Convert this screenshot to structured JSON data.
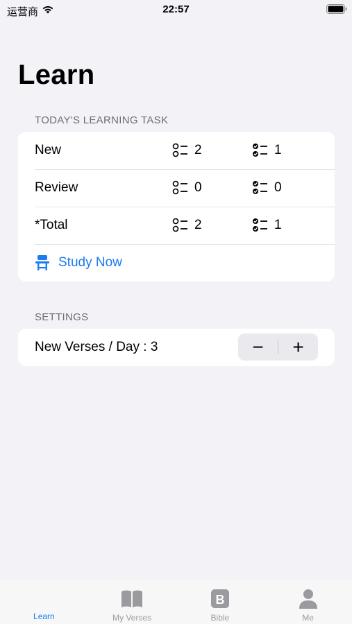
{
  "status_bar": {
    "carrier": "运营商",
    "time": "22:57"
  },
  "page": {
    "title": "Learn"
  },
  "todays_task": {
    "header": "TODAY'S LEARNING TASK",
    "rows": [
      {
        "label": "New",
        "pending": "2",
        "done": "1"
      },
      {
        "label": "Review",
        "pending": "0",
        "done": "0"
      },
      {
        "label": "*Total",
        "pending": "2",
        "done": "1"
      }
    ],
    "study_now_label": "Study Now"
  },
  "settings": {
    "header": "SETTINGS",
    "verses_per_day_label": "New Verses / Day : 3",
    "decrement_symbol": "−",
    "increment_symbol": "+"
  },
  "tab_bar": {
    "tabs": [
      {
        "label": "Learn",
        "icon": "learn-icon",
        "active": true
      },
      {
        "label": "My Verses",
        "icon": "book-icon",
        "active": false
      },
      {
        "label": "Bible",
        "icon": "bible-b-icon",
        "active": false
      },
      {
        "label": "Me",
        "icon": "person-icon",
        "active": false
      }
    ]
  },
  "colors": {
    "accent": "#1a7cf0",
    "background": "#f2f2f7",
    "section_header": "#6d6d72",
    "tab_inactive": "#9a9a9f"
  }
}
